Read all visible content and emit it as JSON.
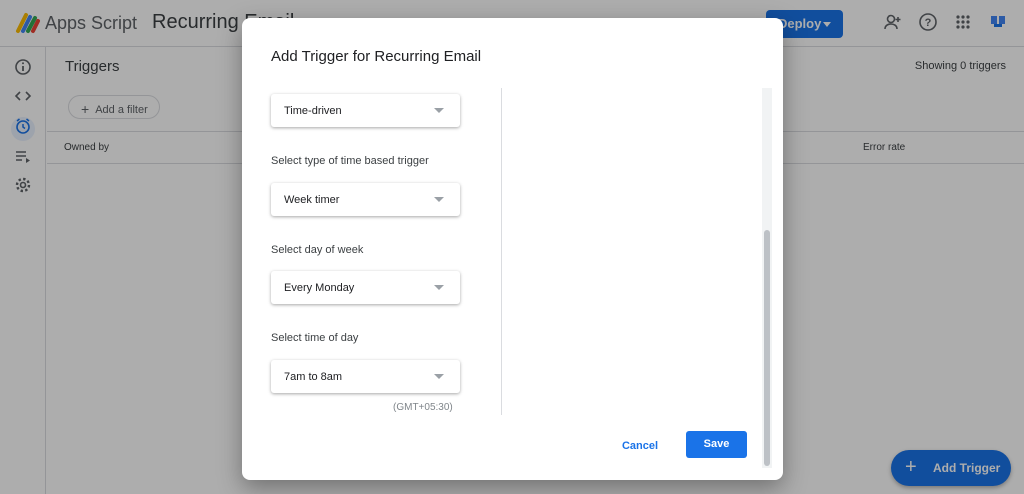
{
  "app": {
    "name": "Apps Script",
    "project_name": "Recurring Email",
    "deploy_label": "Deploy"
  },
  "triggers_page": {
    "title": "Triggers",
    "showing": "Showing 0 triggers",
    "filter_label": "Add a filter",
    "columns": [
      "Owned by",
      "Error rate"
    ],
    "fab_label": "Add Trigger"
  },
  "nav": {
    "icons": [
      "info-icon",
      "code-icon",
      "alarm-clock-icon",
      "executions-icon",
      "gear-icon"
    ],
    "active": "alarm-clock-icon"
  },
  "dialog": {
    "title": "Add Trigger for Recurring Email",
    "event_source": "Time-driven",
    "trigger_type_label": "Select type of time based trigger",
    "trigger_type": "Week timer",
    "day_label": "Select day of week",
    "day": "Every Monday",
    "time_label": "Select time of day",
    "time": "7am to 8am",
    "timezone": "(GMT+05:30)",
    "cancel_label": "Cancel",
    "save_label": "Save"
  },
  "colors": {
    "accent": "#1a73e8",
    "overlay": "rgba(0,0,0,0.32)"
  }
}
